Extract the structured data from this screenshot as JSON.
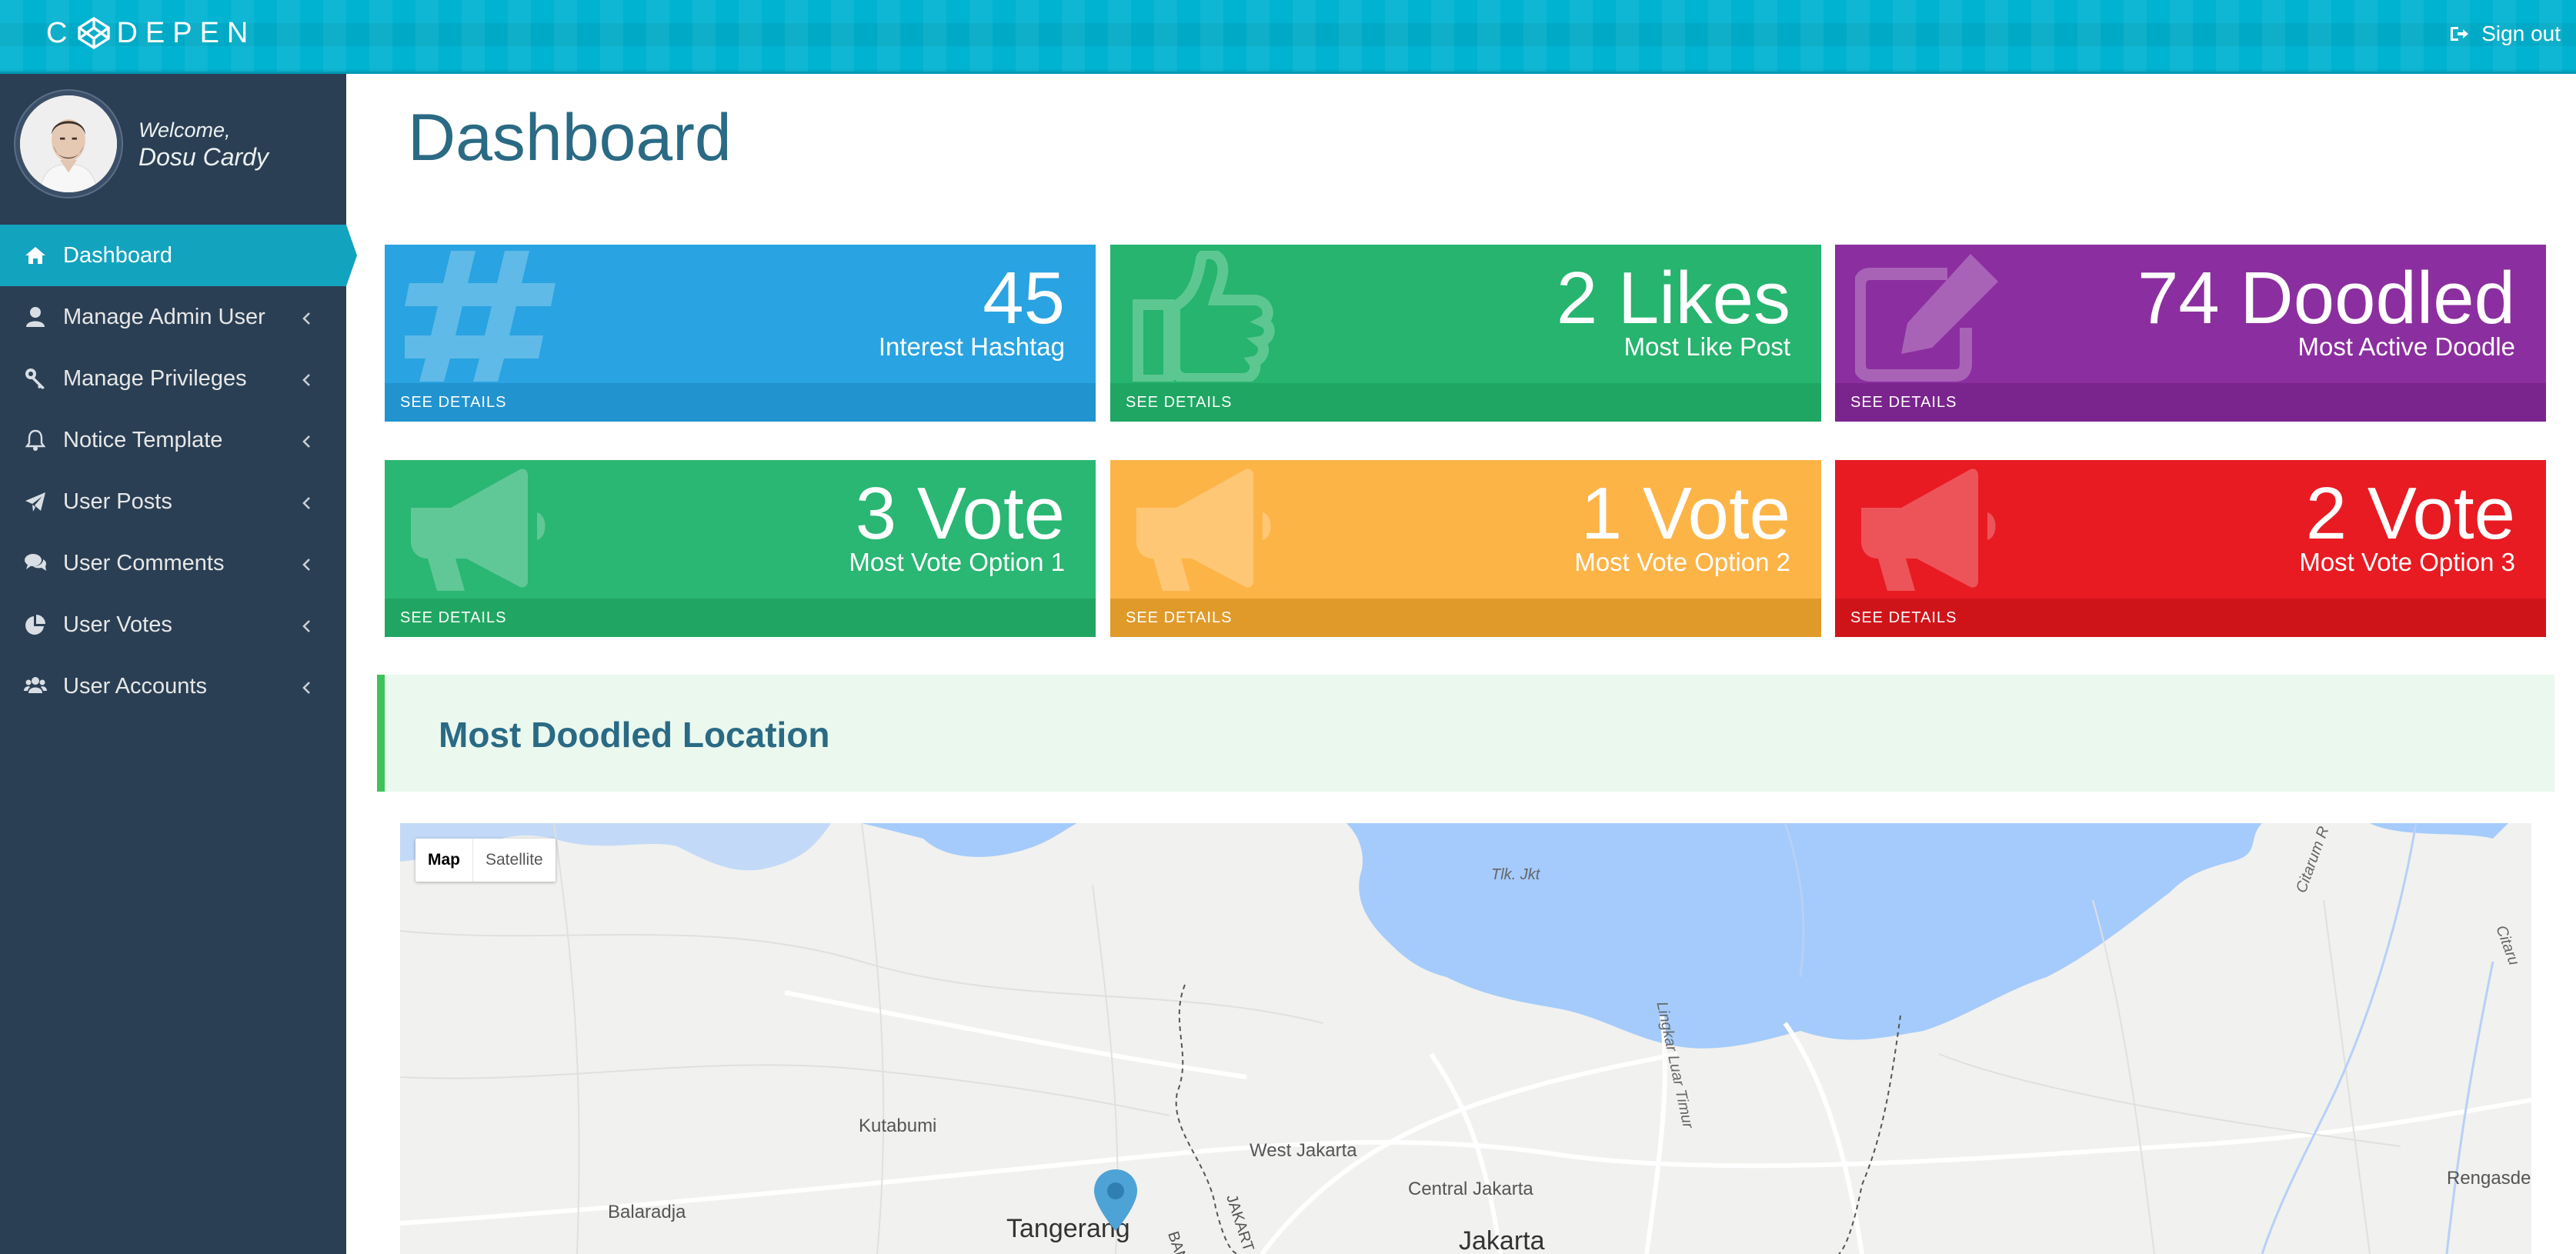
{
  "topbar": {
    "logo_text": "CODEPEN",
    "signout_label": "Sign out"
  },
  "sidebar": {
    "welcome": "Welcome,",
    "username": "Dosu Cardy",
    "items": [
      {
        "label": "Dashboard",
        "icon": "home-icon",
        "active": true
      },
      {
        "label": "Manage Admin User",
        "icon": "user-icon"
      },
      {
        "label": "Manage Privileges",
        "icon": "key-icon"
      },
      {
        "label": "Notice Template",
        "icon": "bell-icon"
      },
      {
        "label": "User Posts",
        "icon": "paper-plane-icon"
      },
      {
        "label": "User Comments",
        "icon": "comments-icon"
      },
      {
        "label": "User Votes",
        "icon": "pie-chart-icon"
      },
      {
        "label": "User Accounts",
        "icon": "users-icon"
      }
    ]
  },
  "main": {
    "title": "Dashboard",
    "tiles": [
      {
        "big": "45",
        "sub": "Interest Hashtag",
        "footer": "SEE DETAILS",
        "color": "#29a3e1",
        "footer_color": "#2193cf",
        "icon": "hashtag-icon"
      },
      {
        "big": "2 Likes",
        "sub": "Most Like Post",
        "footer": "SEE DETAILS",
        "color": "#26b46e",
        "footer_color": "#1ea662",
        "icon": "thumbs-up-icon"
      },
      {
        "big": "74 Doodled",
        "sub": "Most Active Doodle",
        "footer": "SEE DETAILS",
        "color": "#8b2e9f",
        "footer_color": "#7a248d",
        "icon": "edit-icon"
      },
      {
        "big": "3 Vote",
        "sub": "Most Vote Option 1",
        "footer": "SEE DETAILS",
        "color": "#2ab673",
        "footer_color": "#20a662",
        "icon": "megaphone-icon"
      },
      {
        "big": "1 Vote",
        "sub": "Most Vote Option 2",
        "footer": "SEE DETAILS",
        "color": "#fdb447",
        "footer_color": "#e09a2a",
        "icon": "megaphone-icon"
      },
      {
        "big": "2 Vote",
        "sub": "Most Vote Option 3",
        "footer": "SEE DETAILS",
        "color": "#e81b22",
        "footer_color": "#cf1419",
        "icon": "megaphone-icon"
      }
    ],
    "location_title": "Most Doodled Location"
  },
  "map": {
    "toggle": {
      "map": "Map",
      "satellite": "Satellite"
    },
    "labels": {
      "bay": "Tlk. Jkt",
      "kutabumi": "Kutabumi",
      "west_jakarta": "West Jakarta",
      "central_jakarta": "Central Jakarta",
      "balaradja": "Balaradja",
      "tangerang": "Tangerang",
      "jakarta": "Jakarta",
      "rengasdengklok": "Rengasden",
      "ring_road": "Lingkar Luar Timur",
      "citarum": "Citarum R",
      "citaru2": "Citaru",
      "jakart_road": "JAKART",
      "ban": "BAN"
    }
  },
  "colors": {
    "accent": "#12a3bf",
    "sidebar": "#2a3f54",
    "title": "#2a6a84"
  }
}
